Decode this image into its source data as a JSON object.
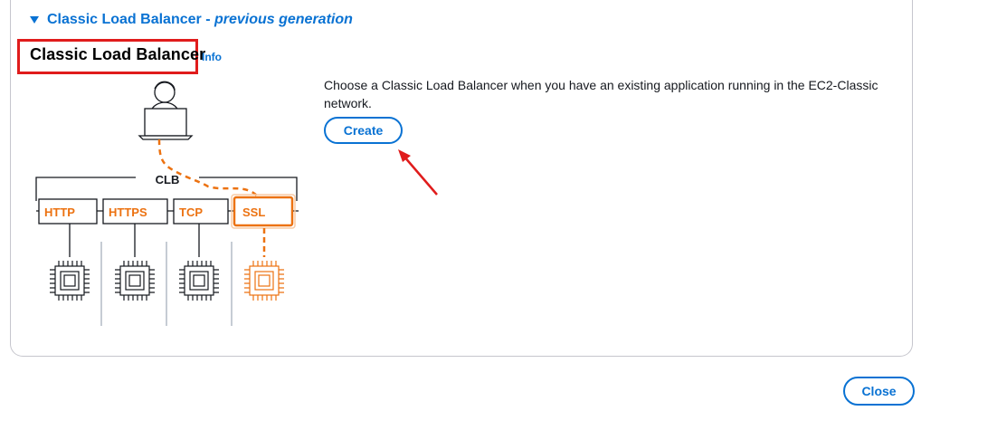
{
  "section": {
    "toggle_label": "Classic Load Balancer",
    "toggle_separator": " - ",
    "toggle_suffix": "previous generation"
  },
  "card": {
    "title": "Classic Load Balancer",
    "info_link": "Info",
    "description": "Choose a Classic Load Balancer when you have an existing application running in the EC2-Classic network.",
    "create_label": "Create"
  },
  "diagram": {
    "group_label": "CLB",
    "listeners": [
      "HTTP",
      "HTTPS",
      "TCP",
      "SSL"
    ],
    "highlighted_listener": "SSL",
    "accent_color": "#ec7211",
    "icons": [
      "user-icon",
      "laptop-icon",
      "chip-icon"
    ]
  },
  "footer": {
    "close_label": "Close"
  },
  "colors": {
    "link": "#0972d3",
    "annotation_red": "#e01c1c",
    "orange": "#ec7211"
  }
}
